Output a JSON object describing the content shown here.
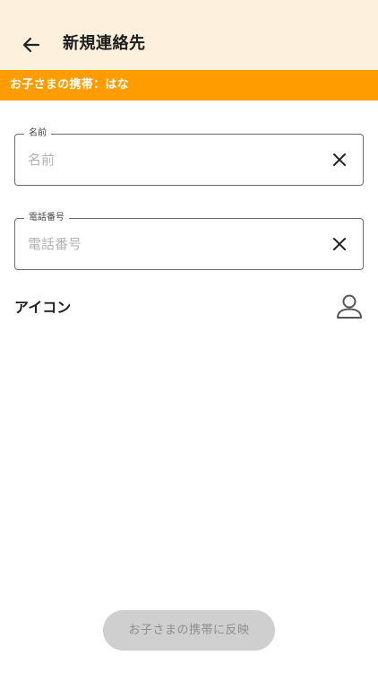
{
  "header": {
    "title": "新規連絡先",
    "back_icon": "arrow-left-icon",
    "background": "#fdf0dc"
  },
  "child_banner": {
    "text": "お子さまの携帯：はな",
    "color": "#ff9d00"
  },
  "form": {
    "name_field": {
      "label": "名前",
      "value": "",
      "placeholder": "名前",
      "clear_icon": "close-icon"
    },
    "phone_field": {
      "label": "電話番号",
      "value": "",
      "placeholder": "電話番号",
      "clear_icon": "close-icon"
    },
    "icon_row": {
      "label": "アイコン",
      "avatar_icon": "person-icon"
    }
  },
  "footer": {
    "submit_label": "お子さまの携帯に反映",
    "enabled": false
  }
}
